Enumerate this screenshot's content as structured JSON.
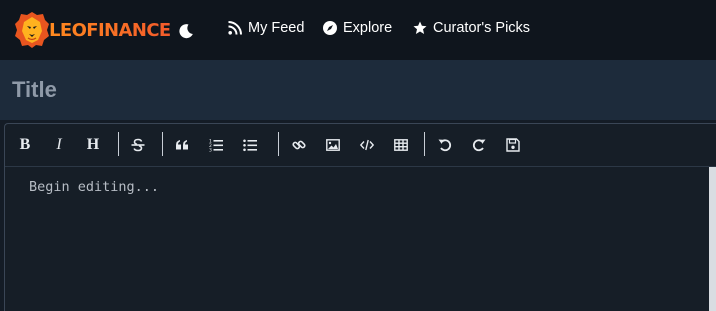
{
  "brand": {
    "logo_text": "LEOFINANCE",
    "primary_color": "#ff8a1f"
  },
  "theme_toggle": {
    "icon": "moon-icon"
  },
  "nav": [
    {
      "id": "feed",
      "label": "My Feed",
      "icon": "rss-icon"
    },
    {
      "id": "explore",
      "label": "Explore",
      "icon": "compass-icon"
    },
    {
      "id": "picks",
      "label": "Curator's Picks",
      "icon": "star-icon"
    }
  ],
  "title_field": {
    "placeholder": "Title",
    "value": ""
  },
  "toolbar": {
    "bold": "B",
    "italic": "I",
    "heading": "H",
    "buttons": [
      "bold-icon",
      "italic-icon",
      "heading-icon",
      "strikethrough-icon",
      "quote-icon",
      "ordered-list-icon",
      "unordered-list-icon",
      "link-icon",
      "image-icon",
      "code-icon",
      "table-icon",
      "undo-icon",
      "redo-icon",
      "save-icon"
    ]
  },
  "editor": {
    "placeholder": "Begin editing..."
  }
}
